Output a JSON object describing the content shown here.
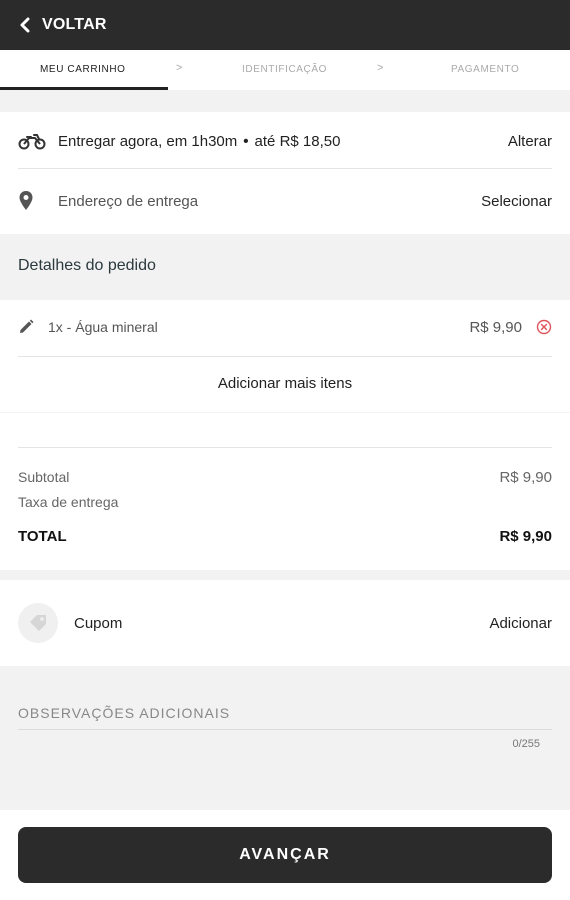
{
  "header": {
    "back_label": "VOLTAR"
  },
  "stepper": {
    "steps": [
      {
        "label": "MEU CARRINHO",
        "active": true
      },
      {
        "label": "IDENTIFICAÇÃO",
        "active": false
      },
      {
        "label": "PAGAMENTO",
        "active": false
      }
    ],
    "separator": ">"
  },
  "delivery": {
    "time_text": "Entregar agora, em 1h30m",
    "fee_text": "até R$ 18,50",
    "time_action": "Alterar",
    "address_text": "Endereço de entrega",
    "address_action": "Selecionar",
    "icons": {
      "delivery": "motorcycle-icon",
      "address": "location-pin-icon"
    }
  },
  "order": {
    "section_title": "Detalhes do pedido",
    "items": [
      {
        "name": "1x - Água mineral",
        "price": "R$ 9,90"
      }
    ],
    "add_more_label": "Adicionar mais itens"
  },
  "summary": {
    "subtotal_label": "Subtotal",
    "subtotal_value": "R$ 9,90",
    "delivery_fee_label": "Taxa de entrega",
    "total_label": "TOTAL",
    "total_value": "R$ 9,90"
  },
  "coupon": {
    "label": "Cupom",
    "action": "Adicionar",
    "icon": "tag-icon"
  },
  "notes": {
    "label": "OBSERVAÇÕES ADICIONAIS",
    "counter": "0/255"
  },
  "footer": {
    "advance_label": "AVANÇAR"
  },
  "colors": {
    "topbar": "#2b2b2b",
    "remove_icon": "#e0525a",
    "background": "#f2f2f2"
  }
}
